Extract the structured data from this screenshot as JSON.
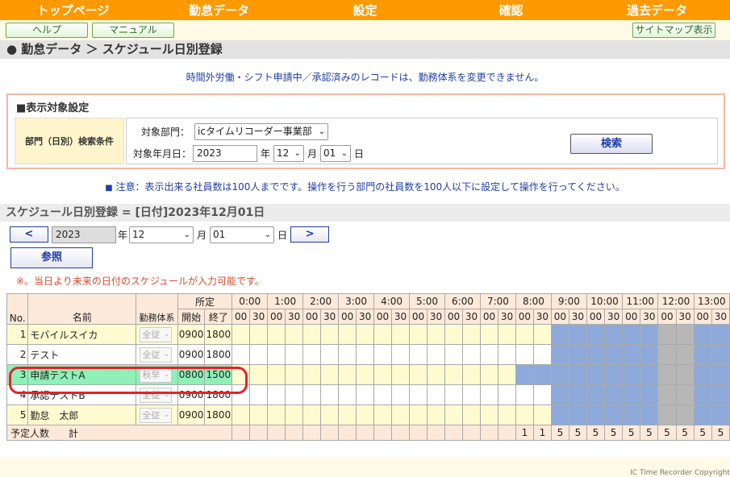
{
  "nav": [
    "トップページ",
    "勤怠データ",
    "設定",
    "確認",
    "過去データ"
  ],
  "buttons": {
    "help": "ヘルプ",
    "manual": "マニュアル",
    "sitemap": "サイトマップ表示"
  },
  "breadcrumb": "● 勤怠データ ＞ スケジュール日別登録",
  "notice1": "時間外労働・シフト申請中／承認済みのレコードは、勤務体系を変更できません。",
  "settings": {
    "heading": "■表示対象設定",
    "label": "部門（日別）検索条件",
    "dept_label": "対象部門：",
    "dept_value": "icタイムリコーダー事業部",
    "date_label": "対象年月日：",
    "year": "2023",
    "year_unit": "年",
    "month": "12",
    "month_unit": "月",
    "day": "01",
    "day_unit": "日",
    "search": "検索"
  },
  "notice2": "注意：表示出来る社員数は100人までです。操作を行う部門の社員数を100人以下に設定して操作を行ってください。",
  "section_title": "スケジュール日別登録 = [日付]2023年12月01日",
  "datenav": {
    "prev": "<",
    "next": ">",
    "year": "2023",
    "year_unit": "年",
    "month": "12",
    "month_unit": "月",
    "day": "01",
    "day_unit": "日"
  },
  "refer": "参照",
  "warning": "※。当日より未来の日付のスケジュールが入力可能です。",
  "table": {
    "h_no": "No.",
    "h_name": "名前",
    "h_type": "勤務体系",
    "h_shotei": "所定",
    "h_start": "開始",
    "h_end": "終了",
    "hours": [
      "0:00",
      "1:00",
      "2:00",
      "3:00",
      "4:00",
      "5:00",
      "6:00",
      "7:00",
      "8:00",
      "9:00",
      "10:00",
      "11:00",
      "12:00",
      "13:00"
    ],
    "half": [
      "00",
      "30"
    ],
    "rows": [
      {
        "no": "1",
        "name": "モバイルスイカ",
        "type": "全従",
        "start": "0900",
        "end": "1800"
      },
      {
        "no": "2",
        "name": "テスト",
        "type": "全従",
        "start": "0900",
        "end": "1800"
      },
      {
        "no": "3",
        "name": "申請テストA",
        "type": "秋早",
        "start": "0800",
        "end": "1500"
      },
      {
        "no": "4",
        "name": "承認テストB",
        "type": "全従",
        "start": "0900",
        "end": "1800"
      },
      {
        "no": "5",
        "name": "勤怠　太郎",
        "type": "全従",
        "start": "0900",
        "end": "1800"
      }
    ],
    "total_label": "予定人数　　計",
    "totals": [
      "1",
      "1",
      "5",
      "5",
      "5",
      "5",
      "5",
      "5",
      "5",
      "5",
      "5",
      "5"
    ]
  },
  "footer": "IC Time Recorder Copyright"
}
